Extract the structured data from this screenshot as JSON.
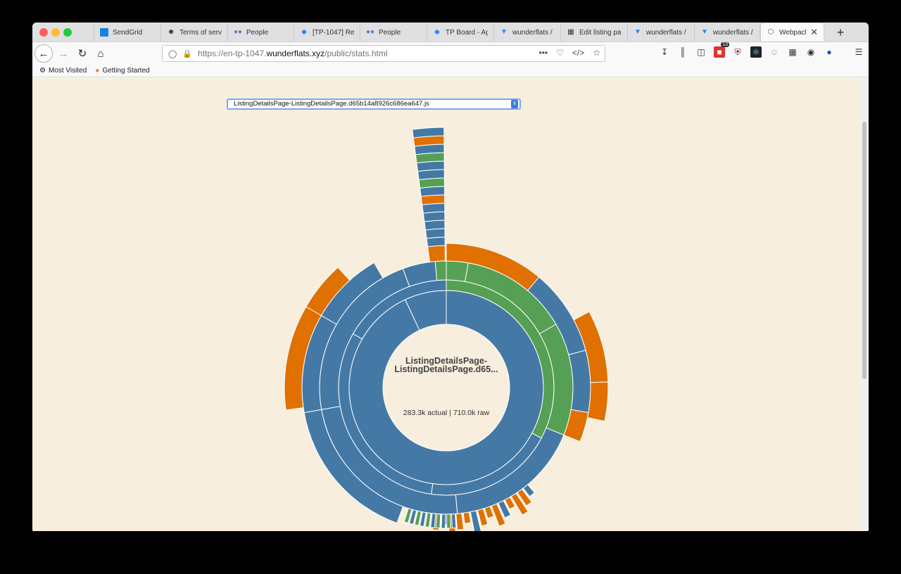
{
  "browser": {
    "tabs": [
      {
        "title": "SendGrid",
        "icon": "sendgrid-icon"
      },
      {
        "title": "Terms of serv",
        "icon": "avatar-icon"
      },
      {
        "title": "People",
        "icon": "people-icon"
      },
      {
        "title": "[TP-1047] Re",
        "icon": "jira-icon"
      },
      {
        "title": "People",
        "icon": "people-icon"
      },
      {
        "title": "TP Board - Ag",
        "icon": "jira-icon"
      },
      {
        "title": "wunderflats /",
        "icon": "bitbucket-icon"
      },
      {
        "title": "Edit listing pa",
        "icon": "checkered-flag-icon"
      },
      {
        "title": "wunderflats /",
        "icon": "bitbucket-icon"
      },
      {
        "title": "wunderflats /",
        "icon": "bitbucket-icon"
      },
      {
        "title": "Webpack",
        "icon": "webpack-icon",
        "active": true
      }
    ],
    "url": {
      "prefix": "https://en-tp-1047.",
      "host": "wunderflats.xyz",
      "path": "/public/stats.html"
    },
    "toolbar_badge": "13",
    "bookmarks": [
      {
        "label": "Most Visited",
        "icon": "gear-icon"
      },
      {
        "label": "Getting Started",
        "icon": "firefox-icon"
      }
    ]
  },
  "page": {
    "chunk_select_value": "ListingDetailsPage-ListingDetailsPage.d65b14a8926c686ea647.js",
    "center_title_line1": "ListingDetailsPage-",
    "center_title_line2": "ListingDetailsPage.d65...",
    "center_stats": "283.3k actual | 710.0k raw"
  },
  "colors": {
    "blue": "#4479a6",
    "green": "#55a054",
    "orange": "#e07000",
    "background": "#f7eedd"
  },
  "chart_data": {
    "type": "sunburst",
    "rings": [
      {
        "level": 1,
        "segments": [
          {
            "share": 0.93,
            "color": "blue"
          },
          {
            "share": 0.07,
            "color": "blue"
          }
        ]
      },
      {
        "level": 2,
        "segments": [
          {
            "share": 0.34,
            "color": "green"
          },
          {
            "share": 0.56,
            "color": "blue"
          },
          {
            "share": 0.1,
            "color": "blue"
          }
        ]
      },
      {
        "level": 3,
        "segments": [
          {
            "share": 0.22,
            "color": "orange"
          },
          {
            "share": 0.15,
            "color": "blue"
          },
          {
            "share": 0.12,
            "color": "green"
          }
        ]
      }
    ]
  }
}
